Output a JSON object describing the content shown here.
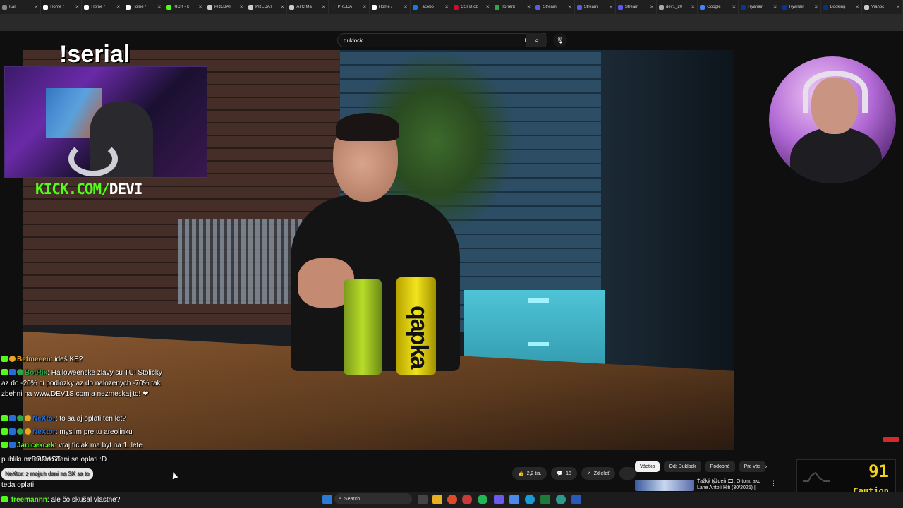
{
  "tabs": [
    {
      "label": "Kár",
      "color": "#888888"
    },
    {
      "label": "Home /",
      "color": "#ffffff"
    },
    {
      "label": "Home /",
      "color": "#ffffff"
    },
    {
      "label": "Home /",
      "color": "#ffffff"
    },
    {
      "label": "KICK - k",
      "color": "#53fc18"
    },
    {
      "label": "PREDAT",
      "color": "#cccccc"
    },
    {
      "label": "PREDAT",
      "color": "#cccccc"
    },
    {
      "label": "ATC Ma",
      "color": "#cccccc"
    },
    {
      "label": "PREDAT",
      "color": "#222222"
    },
    {
      "label": "Home /",
      "color": "#ffffff"
    },
    {
      "label": "Facebo",
      "color": "#1877f2"
    },
    {
      "label": "ČSFD.cz",
      "color": "#c8102e"
    },
    {
      "label": "Torrent",
      "color": "#2aa84a"
    },
    {
      "label": "Stream",
      "color": "#5a5af0"
    },
    {
      "label": "Stream",
      "color": "#5a5af0"
    },
    {
      "label": "Stream",
      "color": "#5a5af0"
    },
    {
      "label": "dev1_20",
      "color": "#aaaaaa"
    },
    {
      "label": "Google",
      "color": "#4285f4"
    },
    {
      "label": "Ryanair",
      "color": "#073590"
    },
    {
      "label": "Ryanair",
      "color": "#073590"
    },
    {
      "label": "Booking",
      "color": "#003580"
    },
    {
      "label": "Vianoč",
      "color": "#cccccc"
    }
  ],
  "search": {
    "value": "duklock"
  },
  "overlay": {
    "command": "!serial",
    "kick_prefix": "KICK.COM/",
    "kick_name": "DEVI"
  },
  "video": {
    "can_text": "qapka"
  },
  "chat": [
    {
      "user": "Betmeeen",
      "color": "#f2a81a",
      "text": ": ideš KE?",
      "badges": [
        "kick",
        "gold"
      ]
    },
    {
      "user": "BotRix",
      "color": "#2aa84a",
      "text": ": Halloweenske zlavy su TU! Stolicky az do -20% ci podlozky az do nalozenych -70% tak zbehni na www.DEV1S.com a nezmeskaj to! ❤",
      "badges": [
        "kick",
        "mod",
        "green"
      ]
    },
    {
      "user": "NeXtor",
      "color": "#2a6cd6",
      "text": ": to sa aj oplati ten let?",
      "badges": [
        "kick",
        "mod",
        "green",
        "gold"
      ]
    },
    {
      "user": "NeXtor",
      "color": "#2a6cd6",
      "text": ": myslím pre tu areolinku",
      "badges": [
        "kick",
        "mod",
        "green",
        "gold"
      ]
    },
    {
      "user": "Janicekcek",
      "color": "#53fc18",
      "text": ": vraj fíciak ma byt na 1. lete",
      "badges": [
        "kick",
        "mod"
      ]
    }
  ],
  "chat_overlapping": [
    {
      "text": "publikum BROAST"
    },
    {
      "text": "z našich dani sa oplati :D"
    },
    {
      "text": "NeXtor: z mojich dani na SK sa to"
    },
    {
      "text": "teda oplati"
    }
  ],
  "chat_bottom": {
    "user": "freemannn",
    "color": "#53fc18",
    "text": ": ale čo skušal vlastne?"
  },
  "actions": {
    "likes": "2,2 tis.",
    "comments": "18",
    "share": "Zdieľať",
    "more": "⋯"
  },
  "chips": [
    "Všetko",
    "Od: Duklock",
    "Podobné",
    "Pre vás"
  ],
  "recommended": {
    "title": "Ťažký týždeň 🎞: O tom, ako Lane Antolí Hiti (30/2025) |"
  },
  "caution": {
    "value": "91",
    "label": "Caution"
  },
  "taskbar": {
    "search_label": "Search"
  }
}
